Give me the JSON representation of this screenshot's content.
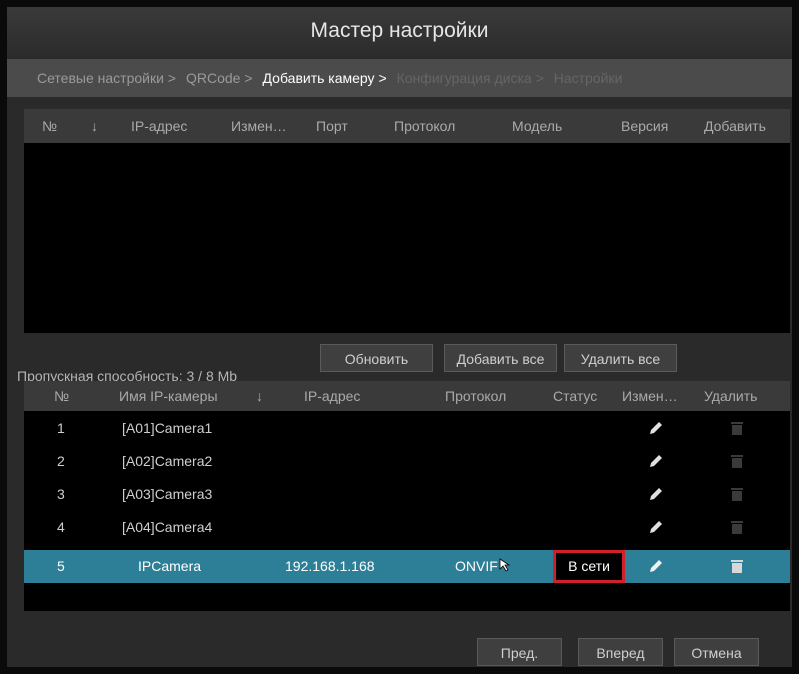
{
  "window": {
    "title": "Мастер настройки"
  },
  "steps": [
    {
      "label": "Сетевые настройки >",
      "state": "done"
    },
    {
      "label": "QRCode >",
      "state": "done"
    },
    {
      "label": "Добавить камеру >",
      "state": "active"
    },
    {
      "label": "Конфигурация диска >",
      "state": "future"
    },
    {
      "label": "Настройки",
      "state": "future"
    }
  ],
  "search_table": {
    "headers": [
      "№",
      "↓",
      "IP-адрес",
      "Измен…",
      "Порт",
      "Протокол",
      "Модель",
      "Версия",
      "Добавить"
    ]
  },
  "actions": {
    "bandwidth": "Пропускная способность: 3 / 8 Mb",
    "refresh": "Обновить",
    "add_all": "Добавить все",
    "delete_all": "Удалить все"
  },
  "added_table": {
    "headers": [
      "№",
      "Имя IP-камеры",
      "↓",
      "IP-адрес",
      "Протокол",
      "Статус",
      "Измен…",
      "Удалить"
    ],
    "rows": [
      {
        "no": "1",
        "name": "[A01]Camera1",
        "ip": "",
        "protocol": "",
        "status": ""
      },
      {
        "no": "2",
        "name": "[A02]Camera2",
        "ip": "",
        "protocol": "",
        "status": ""
      },
      {
        "no": "3",
        "name": "[A03]Camera3",
        "ip": "",
        "protocol": "",
        "status": ""
      },
      {
        "no": "4",
        "name": "[A04]Camera4",
        "ip": "",
        "protocol": "",
        "status": ""
      },
      {
        "no": "5",
        "name": "IPCamera",
        "ip": "192.168.1.168",
        "protocol": "ONVIF",
        "status": "В сети"
      }
    ]
  },
  "footer": {
    "prev": "Пред.",
    "next": "Вперед",
    "cancel": "Отмена"
  },
  "icons": {
    "edit": "pencil-icon",
    "delete": "trash-icon",
    "cursor": "mouse-pointer-icon"
  },
  "colors": {
    "selected_row": "#2d7f97",
    "highlight_border": "#d0202a"
  }
}
